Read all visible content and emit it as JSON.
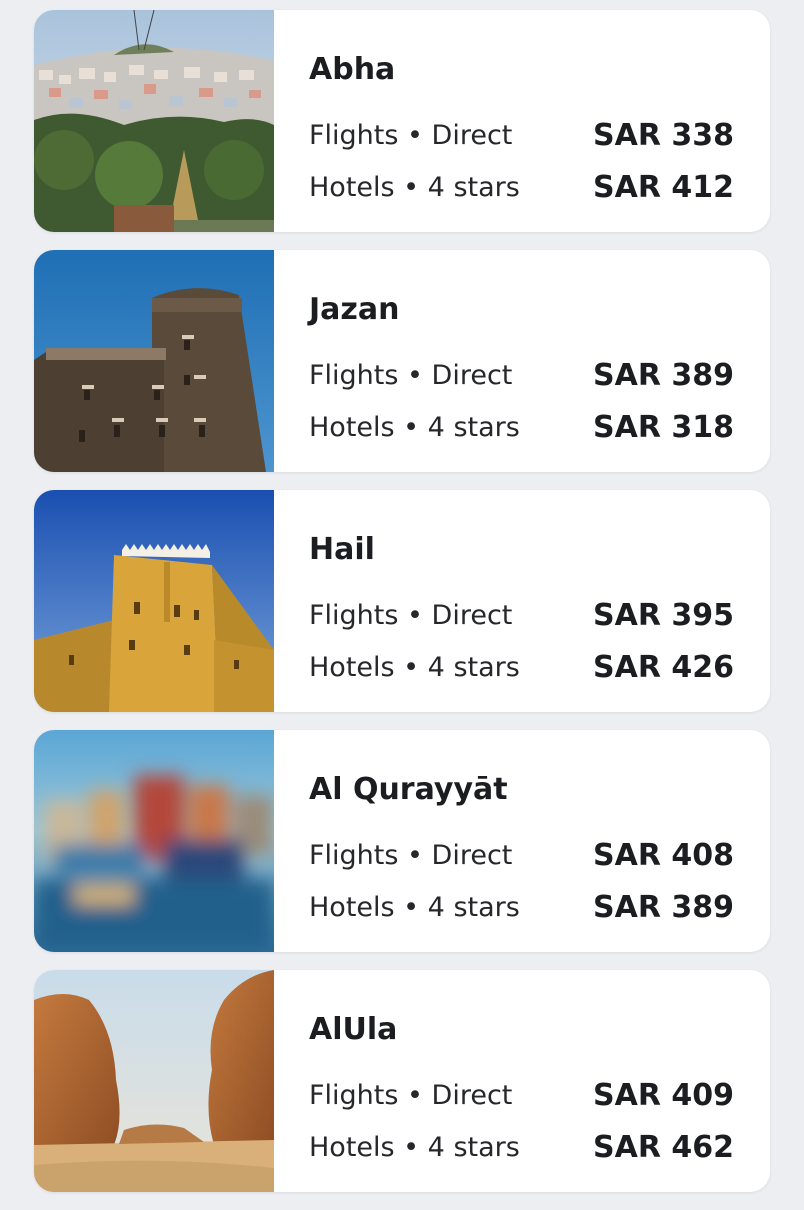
{
  "destinations": [
    {
      "name": "Abha",
      "image_icon": "abha-city-photo",
      "flights_label": "Flights • Direct",
      "flights_price": "SAR 338",
      "hotels_label": "Hotels • 4 stars",
      "hotels_price": "SAR 412"
    },
    {
      "name": "Jazan",
      "image_icon": "jazan-stone-tower-photo",
      "flights_label": "Flights • Direct",
      "flights_price": "SAR 389",
      "hotels_label": "Hotels • 4 stars",
      "hotels_price": "SAR 318"
    },
    {
      "name": "Hail",
      "image_icon": "hail-mud-fort-photo",
      "flights_label": "Flights • Direct",
      "flights_price": "SAR 395",
      "hotels_label": "Hotels • 4 stars",
      "hotels_price": "SAR 426"
    },
    {
      "name": "Al Qurayyāt",
      "image_icon": "al-qurayyat-blurred-photo",
      "flights_label": "Flights • Direct",
      "flights_price": "SAR 408",
      "hotels_label": "Hotels • 4 stars",
      "hotels_price": "SAR 389"
    },
    {
      "name": "AlUla",
      "image_icon": "alula-rock-formation-photo",
      "flights_label": "Flights • Direct",
      "flights_price": "SAR 409",
      "hotels_label": "Hotels • 4 stars",
      "hotels_price": "SAR 462"
    }
  ],
  "colors": {
    "background": "#eceef2",
    "card": "#ffffff",
    "text": "#1c1d21"
  }
}
